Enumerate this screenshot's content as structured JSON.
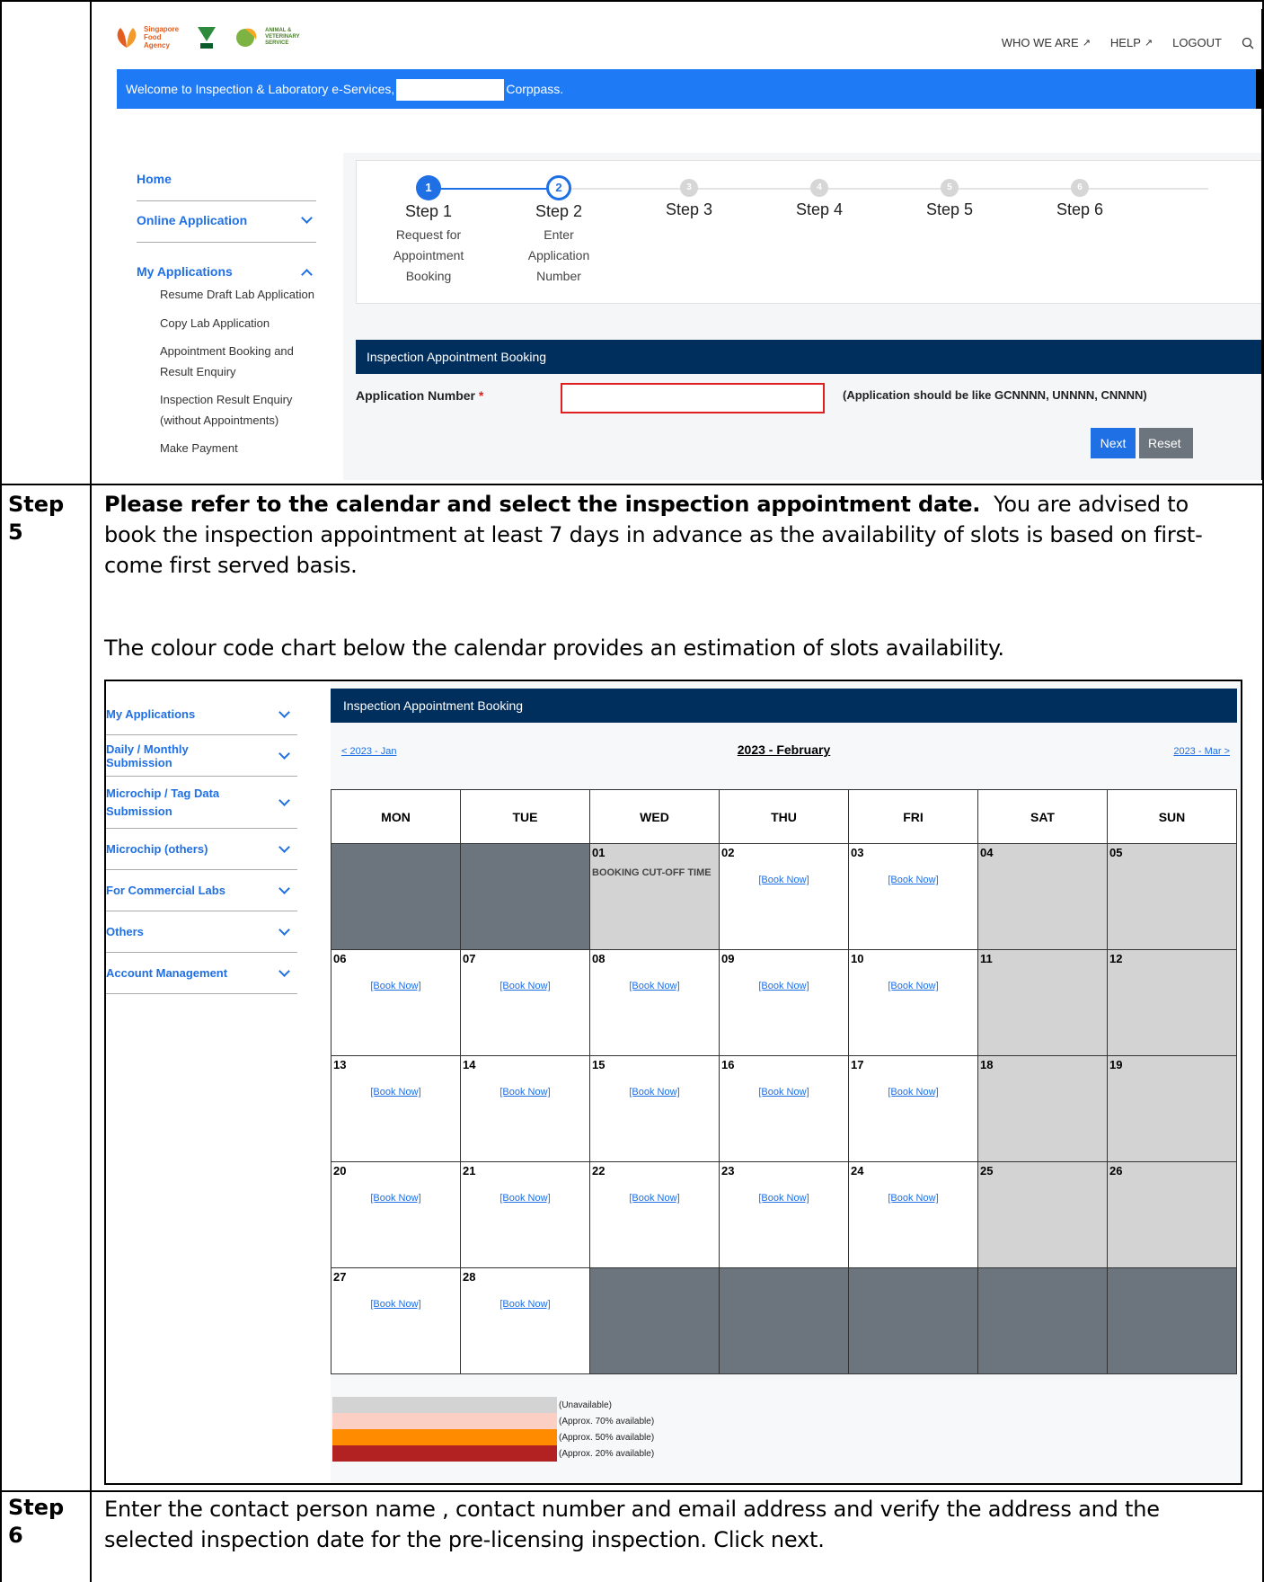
{
  "document": {
    "step5_label": "Step 5",
    "step5_bold": "Please refer to the calendar and select the inspection appointment date.",
    "step5_text": "You are advised to book the inspection appointment at least 7 days in advance as the availability of slots is based on first-come first served basis.",
    "step5_chart_note": "The colour code chart below the calendar provides an estimation of slots availability.",
    "step6_label": "Step 6",
    "step6_text": "Enter the contact person name , contact number and email address and verify the address and the selected inspection date for the pre-licensing inspection.  Click next."
  },
  "portal": {
    "logos": [
      "Singapore Food Agency",
      "National Parks",
      "Animal & Veterinary Service"
    ],
    "topnav": [
      "WHO WE ARE",
      "HELP",
      "LOGOUT"
    ],
    "welcome_prefix": "Welcome to Inspection & Laboratory e-Services,",
    "welcome_suffix": "Corppass.",
    "sidebar": {
      "home": "Home",
      "online_application": "Online Application",
      "my_applications": "My Applications",
      "sub_items": [
        "Resume Draft Lab Application",
        "Copy Lab Application",
        "Appointment Booking and Result Enquiry",
        "Inspection Result Enquiry (without Appointments)",
        "Make Payment"
      ]
    },
    "steps": [
      {
        "num": "1",
        "title": "Step 1",
        "desc": "Request for Appointment Booking",
        "state": "done"
      },
      {
        "num": "2",
        "title": "Step 2",
        "desc": "Enter Application Number",
        "state": "current"
      },
      {
        "num": "3",
        "title": "Step 3",
        "desc": "",
        "state": "todo"
      },
      {
        "num": "4",
        "title": "Step 4",
        "desc": "",
        "state": "todo"
      },
      {
        "num": "5",
        "title": "Step 5",
        "desc": "",
        "state": "todo"
      },
      {
        "num": "6",
        "title": "Step 6",
        "desc": "",
        "state": "todo"
      }
    ],
    "form": {
      "section_title": "Inspection Appointment Booking",
      "app_number_label": "Application Number",
      "required_mark": "*",
      "app_number_value": "",
      "hint": "(Application should be like GCNNNN, UNNNN, CNNNN)",
      "next_label": "Next",
      "reset_label": "Reset"
    }
  },
  "booking": {
    "sidebar": [
      "My Applications",
      "Daily / Monthly Submission",
      "Microchip / Tag Data Submission",
      "Microchip (others)",
      "For Commercial Labs",
      "Others",
      "Account Management"
    ],
    "section_title": "Inspection Appointment Booking",
    "prev_month": "< 2023 - Jan",
    "month_title": "2023 - February",
    "next_month": "2023 - Mar >",
    "weekdays": [
      "MON",
      "TUE",
      "WED",
      "THU",
      "FRI",
      "SAT",
      "SUN"
    ],
    "book_label": "[Book Now]",
    "cutoff_label": "BOOKING CUT-OFF TIME",
    "weeks": [
      [
        {
          "state": "blank"
        },
        {
          "state": "blank"
        },
        {
          "day": "01",
          "state": "cutoff"
        },
        {
          "day": "02",
          "state": "avail"
        },
        {
          "day": "03",
          "state": "avail"
        },
        {
          "day": "04",
          "state": "unavail"
        },
        {
          "day": "05",
          "state": "unavail"
        }
      ],
      [
        {
          "day": "06",
          "state": "avail"
        },
        {
          "day": "07",
          "state": "avail"
        },
        {
          "day": "08",
          "state": "avail"
        },
        {
          "day": "09",
          "state": "avail"
        },
        {
          "day": "10",
          "state": "avail"
        },
        {
          "day": "11",
          "state": "unavail"
        },
        {
          "day": "12",
          "state": "unavail"
        }
      ],
      [
        {
          "day": "13",
          "state": "avail"
        },
        {
          "day": "14",
          "state": "avail"
        },
        {
          "day": "15",
          "state": "avail"
        },
        {
          "day": "16",
          "state": "avail"
        },
        {
          "day": "17",
          "state": "avail"
        },
        {
          "day": "18",
          "state": "unavail"
        },
        {
          "day": "19",
          "state": "unavail"
        }
      ],
      [
        {
          "day": "20",
          "state": "avail"
        },
        {
          "day": "21",
          "state": "avail"
        },
        {
          "day": "22",
          "state": "avail"
        },
        {
          "day": "23",
          "state": "avail"
        },
        {
          "day": "24",
          "state": "avail"
        },
        {
          "day": "25",
          "state": "unavail"
        },
        {
          "day": "26",
          "state": "unavail"
        }
      ],
      [
        {
          "day": "27",
          "state": "avail"
        },
        {
          "day": "28",
          "state": "avail"
        },
        {
          "state": "blank"
        },
        {
          "state": "blank"
        },
        {
          "state": "blank"
        },
        {
          "state": "blank"
        },
        {
          "state": "blank"
        }
      ]
    ],
    "legend": [
      {
        "label": "(Unavailable)",
        "color": "#d3d3d3"
      },
      {
        "label": "(Approx. 70% available)",
        "color": "#fbcfc4"
      },
      {
        "label": "(Approx. 50% available)",
        "color": "#ff8c00"
      },
      {
        "label": "(Approx. 20% available)",
        "color": "#b22222"
      }
    ]
  }
}
